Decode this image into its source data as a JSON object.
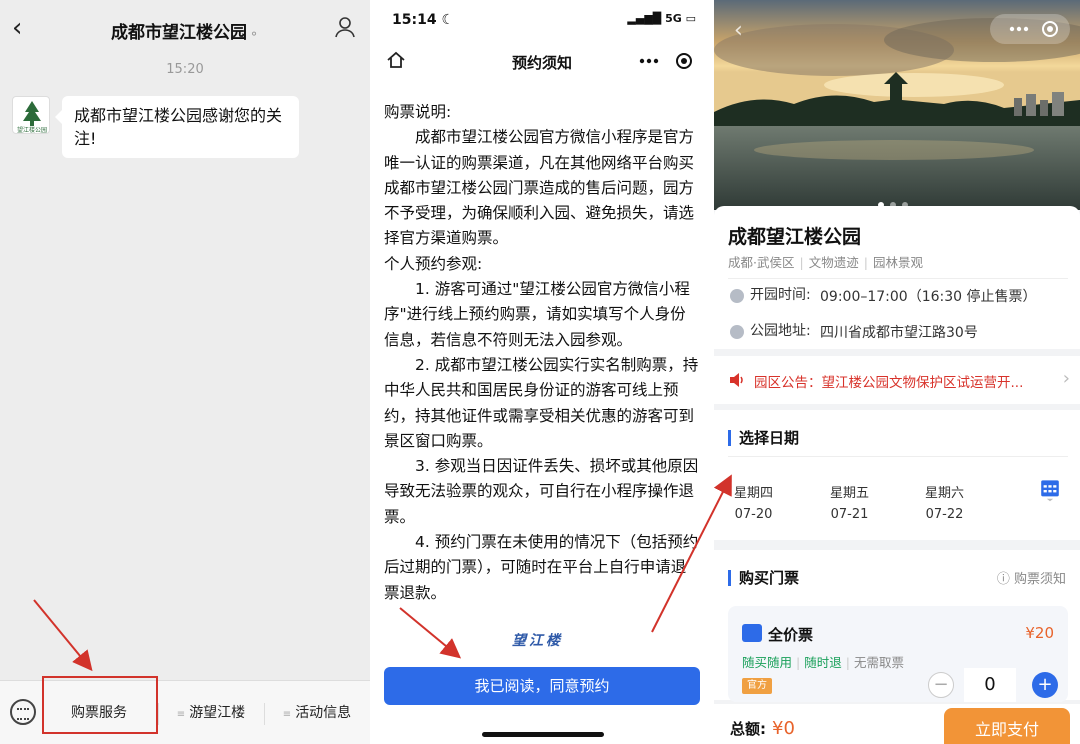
{
  "panel1": {
    "title": "成都市望江楼公园",
    "time": "15:20",
    "message": "成都市望江楼公园感谢您的关注!",
    "avatar_label": "望江楼公园",
    "menu": [
      "购票服务",
      "游望江楼",
      "活动信息"
    ]
  },
  "panel2": {
    "status_time": "15:14",
    "status_net": "5G",
    "title": "预约须知",
    "paragraphs": [
      "购票说明:",
      "成都市望江楼公园官方微信小程序是官方唯一认证的购票渠道，凡在其他网络平台购买成都市望江楼公园门票造成的售后问题，园方不予受理，为确保顺利入园、避免损失，请选择官方渠道购票。",
      "个人预约参观:",
      "1. 游客可通过\"望江楼公园官方微信小程序\"进行线上预约购票，请如实填写个人身份信息，若信息不符则无法入园参观。",
      "2. 成都市望江楼公园实行实名制购票，持中华人民共和国居民身份证的游客可线上预约，持其他证件或需享受相关优惠的游客可到景区窗口购票。",
      "3. 参观当日因证件丢失、损坏或其他原因导致无法验票的观众，可自行在小程序操作退票。",
      "4. 预约门票在未使用的情况下（包括预约后过期的门票），可随时在平台上自行申请退票退款。"
    ],
    "stamp": "望江楼",
    "agree_button": "我已阅读，同意预约"
  },
  "panel3": {
    "park_name": "成都望江楼公园",
    "tags": [
      "成都·武侯区",
      "文物遗迹",
      "园林景观"
    ],
    "hours_label": "开园时间:",
    "hours_value": "09:00–17:00（16:30 停止售票）",
    "address_label": "公园地址:",
    "address_value": "四川省成都市望江路30号",
    "notice": "园区公告：望江楼公园文物保护区试运营开...",
    "date_section": "选择日期",
    "days": [
      {
        "week": "星期四",
        "date": "07-20"
      },
      {
        "week": "星期五",
        "date": "07-21"
      },
      {
        "week": "星期六",
        "date": "07-22"
      }
    ],
    "ticket_section": "购买门票",
    "ticket_notice": "购票须知",
    "ticket_name": "全价票",
    "ticket_price": "¥20",
    "features": [
      "随买随用",
      "随时退",
      "无需取票"
    ],
    "official_badge": "官方",
    "quantity": "0",
    "total_label": "总额:",
    "total_value": "¥0",
    "pay_button": "立即支付"
  },
  "colors": {
    "accent_blue": "#2d6be8",
    "alert_red": "#d8332b",
    "price_orange": "#e8632b",
    "pay_orange": "#f29437",
    "wechat_bg": "#ededed"
  }
}
